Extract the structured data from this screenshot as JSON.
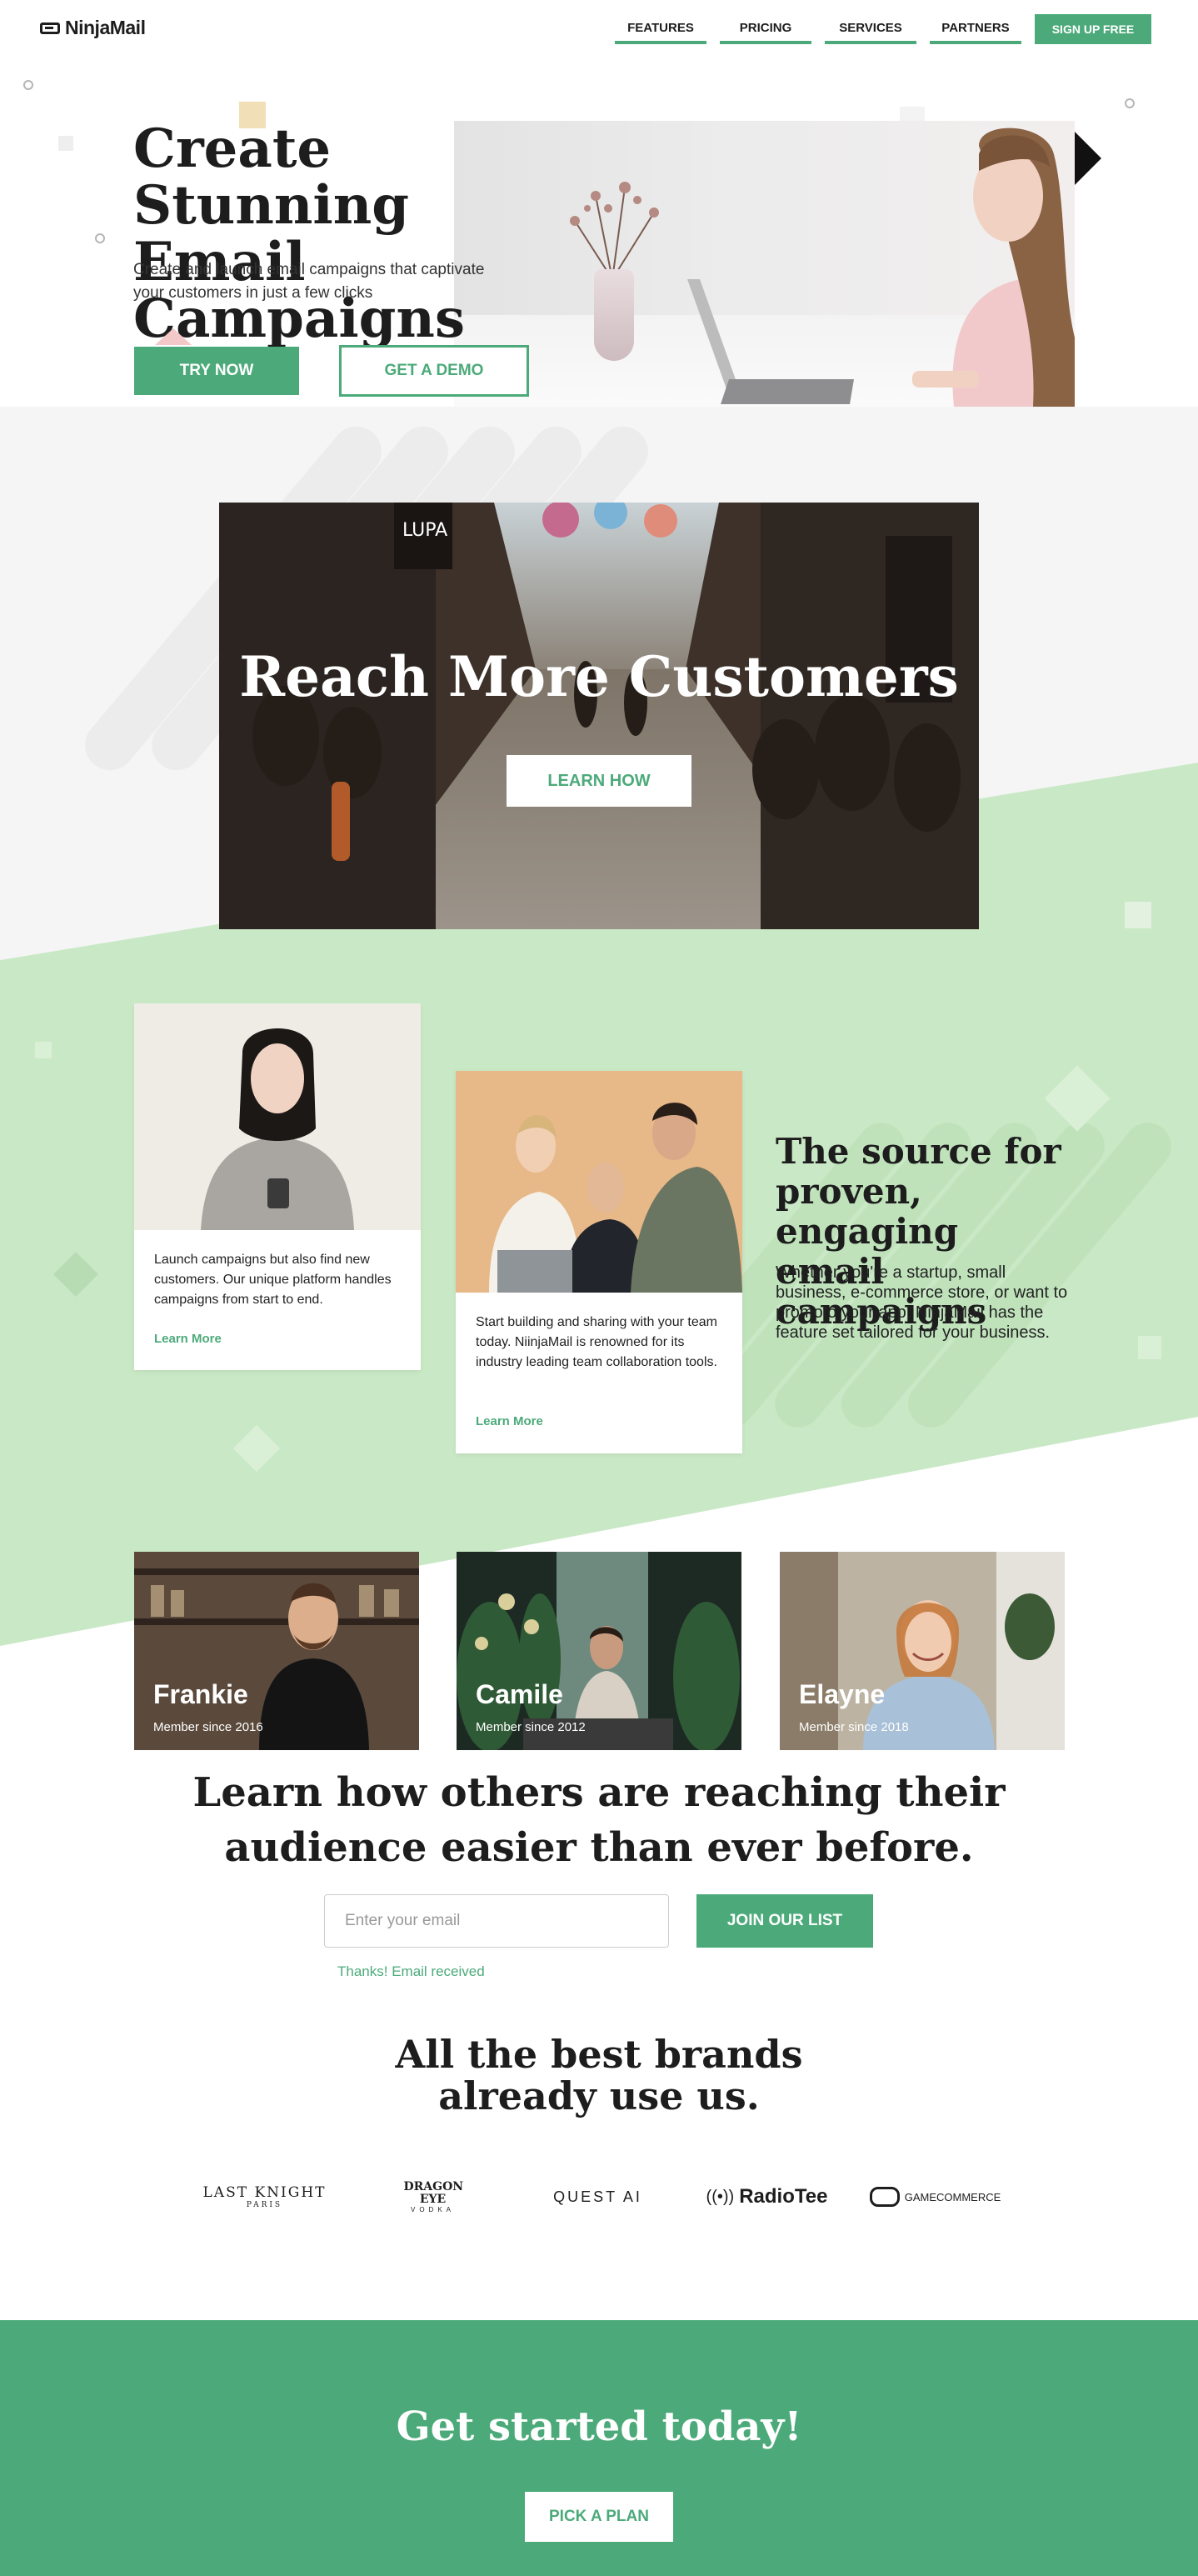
{
  "colors": {
    "accent": "#4caa7a",
    "mint": "#c9e8c5",
    "dark": "#1d1d1d"
  },
  "nav": {
    "logo_text": "NinjaMail",
    "logo_icon": "mask-icon",
    "links": [
      "FEATURES",
      "PRICING",
      "SERVICES",
      "PARTNERS"
    ],
    "cta": "SIGN UP FREE"
  },
  "hero": {
    "title_line1": "Create Stunning",
    "title_line2": "Email Campaigns",
    "subtitle_line1": "Create and launch email campaigns that captivate",
    "subtitle_line2": "your customers in just a few clicks",
    "primary_cta": "TRY NOW",
    "secondary_cta": "GET A DEMO"
  },
  "banner": {
    "title": "Reach More Customers",
    "cta": "LEARN HOW",
    "sign_text": "LUPA"
  },
  "features": {
    "cards": [
      {
        "text": "Launch campaigns but also find new customers. Our unique platform handles campaigns from start to end.",
        "link": "Learn More"
      },
      {
        "text": "Start building and sharing with your team today. NiinjaMail is renowned for its industry leading team collaboration tools.",
        "link": "Learn More"
      }
    ],
    "title": "The source for proven, engaging email campaigns",
    "text": "Whether you're a startup, small business, e-commerce store, or want to promoto your app. NinjaMail has the feature set tailored for your business."
  },
  "members": [
    {
      "name": "Frankie",
      "since": "Member since 2016"
    },
    {
      "name": "Camile",
      "since": "Member since 2012"
    },
    {
      "name": "Elayne",
      "since": "Member since 2018"
    }
  ],
  "signup": {
    "title_line1": "Learn how others are reaching their",
    "title_line2": "audience easier than ever before.",
    "placeholder": "Enter your email",
    "button": "JOIN OUR LIST",
    "confirmation": "Thanks! Email received"
  },
  "brands": {
    "title_line1": "All the best brands",
    "title_line2": "already use us.",
    "logos": [
      {
        "name": "LAST KNIGHT",
        "sub": "PARIS"
      },
      {
        "name": "DRAGON EYE",
        "sub": "VODKA"
      },
      {
        "name": "QUEST AI"
      },
      {
        "name": "RadioTee"
      },
      {
        "name": "GAMECOMMERCE"
      }
    ]
  },
  "cta": {
    "title": "Get started today!",
    "button": "PICK A PLAN"
  }
}
